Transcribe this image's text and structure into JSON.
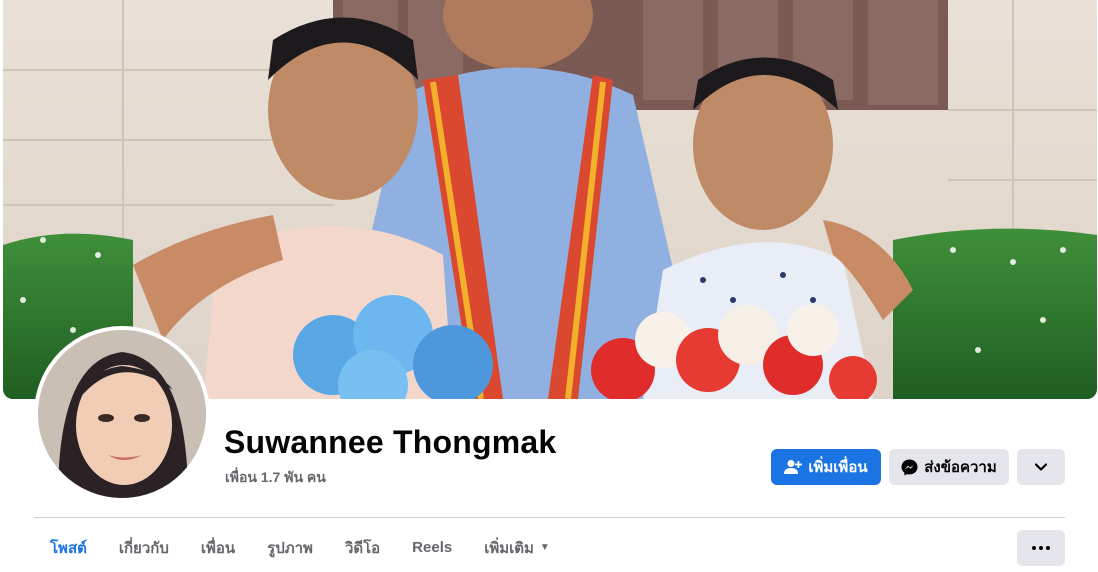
{
  "profile": {
    "name": "Suwannee Thongmak",
    "friends": "เพื่อน 1.7 พัน คน"
  },
  "actions": {
    "add_friend": "เพิ่มเพื่อน",
    "message": "ส่งข้อความ"
  },
  "tabs": [
    {
      "label": "โพสต์",
      "active": true
    },
    {
      "label": "เกี่ยวกับ",
      "active": false
    },
    {
      "label": "เพื่อน",
      "active": false
    },
    {
      "label": "รูปภาพ",
      "active": false
    },
    {
      "label": "วิดีโอ",
      "active": false
    },
    {
      "label": "Reels",
      "active": false
    },
    {
      "label": "เพิ่มเติม",
      "active": false
    }
  ],
  "colors": {
    "accent": "#1b74e4",
    "button_secondary": "#e4e6eb",
    "muted_text": "#65676b"
  },
  "icons": {
    "add_friend": "person-plus-icon",
    "message": "messenger-icon",
    "more": "chevron-down-icon",
    "tab_more": "ellipsis-icon"
  }
}
